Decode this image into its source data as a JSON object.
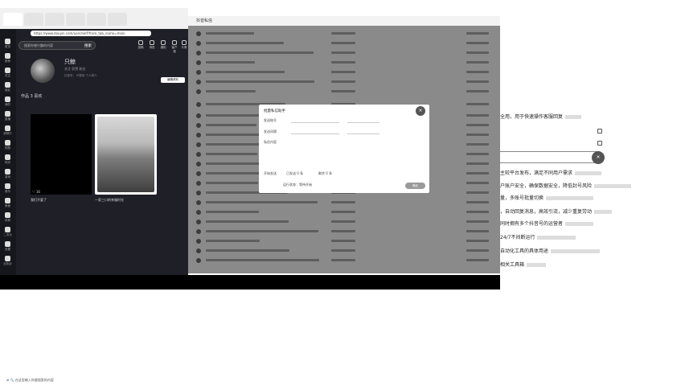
{
  "left_browser": {
    "address": "https://www.douyin.com/user/self?from_tab_name=main",
    "search_button": "搜索",
    "profile_name": "只鲸",
    "profile_stats": "关注 获赞 粉丝",
    "profile_bio": "抖音号：  IP属地  个人简介",
    "edit_button": "编辑资料",
    "profile_tabs": "作品 3    喜欢",
    "video1_likes": "♡ 16",
    "video1_caption": "我们不要了",
    "video2_caption": "一家三口的幸福时光",
    "sidebar": [
      {
        "icon": "home-icon",
        "label": "首页"
      },
      {
        "icon": "recommend-icon",
        "label": "推荐"
      },
      {
        "icon": "follow-icon",
        "label": "关注"
      },
      {
        "icon": "friends-icon",
        "label": "朋友"
      },
      {
        "icon": "me-icon",
        "label": "我的"
      },
      {
        "icon": "live-icon",
        "label": "直播"
      },
      {
        "icon": "cinema-icon",
        "label": "放映厅"
      },
      {
        "icon": "short-drama-icon",
        "label": "短剧"
      },
      {
        "icon": "knowledge-icon",
        "label": "知识"
      },
      {
        "icon": "game-icon",
        "label": "游戏"
      },
      {
        "icon": "music-icon",
        "label": "音乐"
      },
      {
        "icon": "food-icon",
        "label": "美食"
      },
      {
        "icon": "sports-icon",
        "label": "体育"
      },
      {
        "icon": "anime-icon",
        "label": "二次元"
      },
      {
        "icon": "settings-icon",
        "label": "设置"
      },
      {
        "icon": "business-icon",
        "label": "业务合作"
      }
    ],
    "top_icons": [
      {
        "icon": "upload-icon",
        "label": "投稿"
      },
      {
        "icon": "message-icon",
        "label": "消息"
      },
      {
        "icon": "notification-icon",
        "label": "通知"
      },
      {
        "icon": "client-icon",
        "label": "客户端"
      },
      {
        "icon": "avatar-icon",
        "label": "头像"
      }
    ]
  },
  "mid_window": {
    "title": "抖音私信",
    "dialog": {
      "title": "批量私信助手",
      "field1": "发送账号",
      "field2": "发送间隔",
      "field3": "私信内容",
      "footer1": "开始发送",
      "footer2": "已发送 0 条",
      "footer3": "剩余 0 条",
      "footer4": "运行状态：等待开始",
      "confirm": "确定"
    }
  },
  "right_panel": {
    "lines": [
      "全用，用于快速操作客服回复",
      "主较平台发布，满足不同用户需求",
      "户账户安全，确保数据安全，降低封号风险",
      "量，多账号批量切换",
      "，自动回复消息，高效引流，减少重复劳动",
      "同时拥有多个抖音号的运营者",
      "24/7不间断运行",
      "自动化工具的具体用途",
      "相关工具箱"
    ],
    "close_label": "×"
  },
  "taskbar": {
    "text": "⊞ 🔍 在这里输入你要搜索的内容"
  }
}
